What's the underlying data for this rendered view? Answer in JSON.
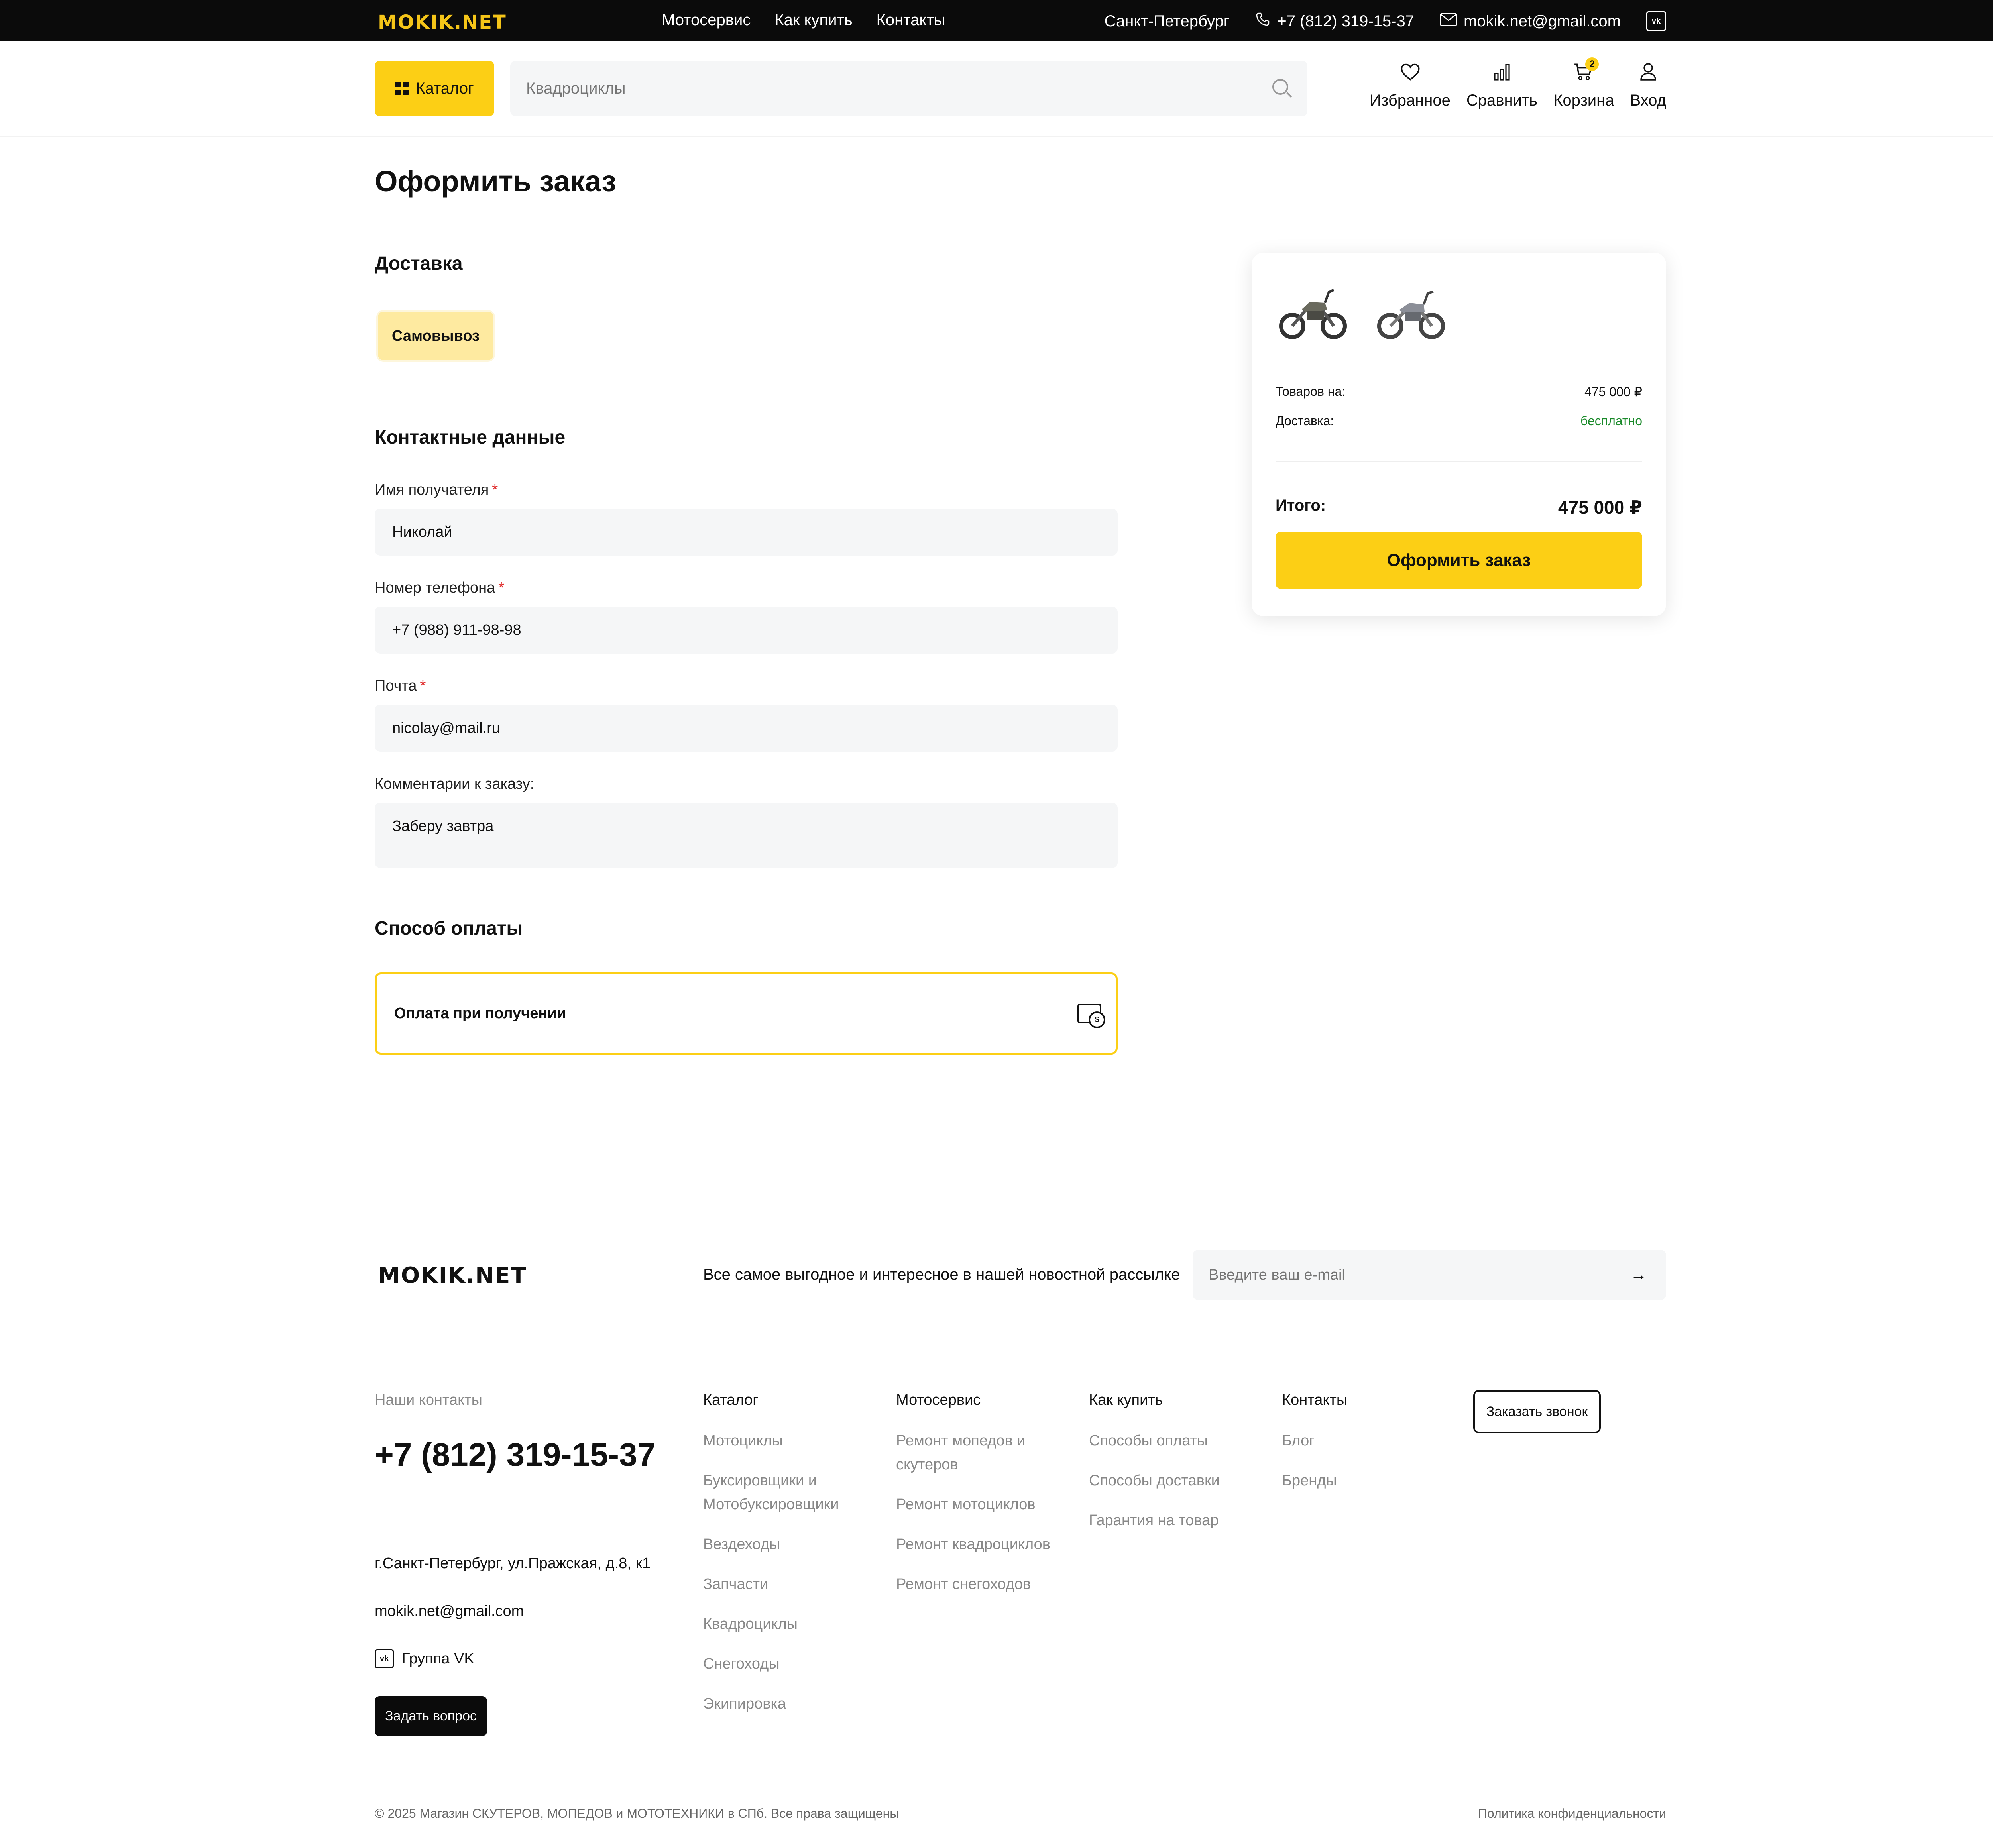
{
  "topbar": {
    "logo": "MOKIK.NET",
    "nav": [
      "Мотосервис",
      "Как купить",
      "Контакты"
    ],
    "city": "Санкт-Петербург",
    "phone": "+7 (812) 319-15-37",
    "email": "mokik.net@gmail.com",
    "vk_icon": "vk-icon"
  },
  "header": {
    "catalog_label": "Каталог",
    "search_placeholder": "Квадроциклы",
    "icons": {
      "favorites": "Избранное",
      "compare": "Сравнить",
      "cart": "Корзина",
      "cart_count": "2",
      "login": "Вход"
    }
  },
  "main": {
    "title": "Оформить заказ",
    "delivery": {
      "title": "Доставка",
      "option": "Самовывоз"
    },
    "contacts": {
      "title": "Контактные данные",
      "name_label": "Имя получателя",
      "name_value": "Николай",
      "phone_label": "Номер телефона",
      "phone_value": "+7 (988) 911-98-98",
      "email_label": "Почта",
      "email_value": "nicolay@mail.ru",
      "comment_label": "Комментарии к заказу:",
      "comment_value": "Заберу завтра",
      "required_mark": "*"
    },
    "payment": {
      "title": "Способ оплаты",
      "option": "Оплата при получении"
    }
  },
  "summary": {
    "goods_label": "Товаров на:",
    "goods_value": "475 000 ₽",
    "delivery_label": "Доставка:",
    "delivery_value": "бесплатно",
    "total_label": "Итого:",
    "total_value": "475 000 ₽",
    "order_button": "Оформить заказ",
    "colors": {
      "accent": "#fccf15",
      "free": "#1a8a2a"
    }
  },
  "footer": {
    "logo": "MOKIK.NET",
    "newsletter_text": "Все самое выгодное и интересное в нашей новостной рассылке",
    "newsletter_placeholder": "Введите ваш e-mail",
    "contacts_heading": "Наши контакты",
    "phone": "+7 (812) 319-15-37",
    "address": "г.Санкт-Петербург, ул.Пражская, д.8, к1",
    "email": "mokik.net@gmail.com",
    "vk_group": "Группа VK",
    "ask_button": "Задать вопрос",
    "call_button": "Заказать звонок",
    "catalog": {
      "heading": "Каталог",
      "links": [
        "Мотоциклы",
        "Буксировщики и Мотобуксировщики",
        "Вездеходы",
        "Запчасти",
        "Квадроциклы",
        "Снегоходы",
        "Экипировка"
      ]
    },
    "service": {
      "heading": "Мотосервис",
      "links": [
        "Ремонт мопедов и скутеров",
        "Ремонт мотоциклов",
        "Ремонт квадроциклов",
        "Ремонт снегоходов"
      ]
    },
    "howto": {
      "heading": "Как купить",
      "links": [
        "Способы оплаты",
        "Способы доставки",
        "Гарантия на товар"
      ]
    },
    "contactsnav": {
      "heading": "Контакты",
      "links": [
        "Блог",
        "Бренды"
      ]
    },
    "copyright": "© 2025 Магазин СКУТЕРОВ, МОПЕДОВ и МОТОТЕХНИКИ в СПб. Все права защищены",
    "policy": "Политика конфиденциальности"
  }
}
